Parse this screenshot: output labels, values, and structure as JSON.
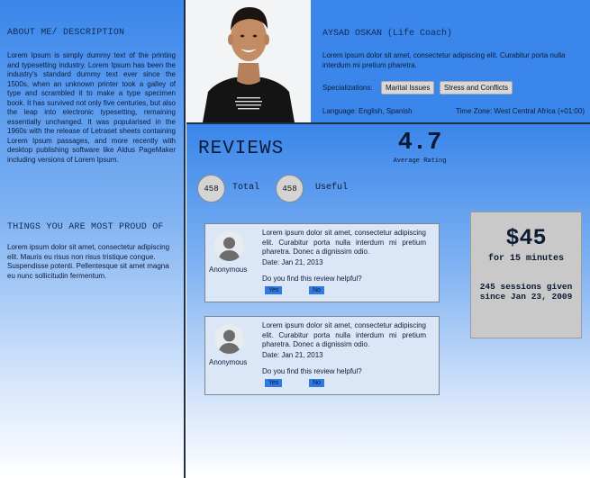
{
  "about": {
    "heading": "ABOUT ME/ DESCRIPTION",
    "text": "Lorem Ipsum is simply dummy text of the printing and typesetting industry. Lorem Ipsum has been the industry's standard dummy text ever since the 1500s, when an unknown printer took a galley of type and scrambled it to make a type specimen book. It has survived not only five centuries, but also the leap into electronic typesetting, remaining essentially unchanged. It was popularised in the 1960s with the release of Letraset sheets containing Lorem Ipsum passages, and more recently with desktop publishing software like Aldus PageMaker including versions of Lorem Ipsum."
  },
  "proud": {
    "heading": "THINGS YOU ARE MOST PROUD OF",
    "text": "Lorem ipsum dolor sit amet, consectetur adipiscing elit. Mauris eu risus non risus tristique congue. Suspendisse potenti. Pellentesque sit amet magna eu nunc sollicitudin fermentum."
  },
  "coach": {
    "name": "AYSAD OSKAN (Life Coach)",
    "description": "Lorem ipsum dolor sit amet, consectetur adipiscing elit. Curabitur porta nulla interdum mi pretium pharetra.",
    "specializations_label": "Specializations:",
    "specializations": [
      "Marital Issues",
      "Stress and Conflicts"
    ],
    "language": "Language: English, Spanish",
    "timezone": "Time Zone: West Central Africa (+01:00)"
  },
  "reviews": {
    "title": "REVIEWS",
    "average_rating": "4.7",
    "average_label": "Average Rating",
    "total_count": "458",
    "total_label": "Total",
    "useful_count": "458",
    "useful_label": "Useful",
    "items": [
      {
        "author": "Anonymous",
        "text": "Lorem ipsum dolor sit amet, consectetur adipiscing elit. Curabitur porta nulla interdum mi pretium pharetra. Donec a dignissim odio.",
        "date": "Date: Jan 21, 2013",
        "question": "Do you find this review helpful?",
        "yes": "Yes",
        "no": "No"
      },
      {
        "author": "Anonymous",
        "text": "Lorem ipsum dolor sit amet, consectetur adipiscing elit. Curabitur porta nulla interdum mi pretium pharetra. Donec a dignissim odio.",
        "date": "Date: Jan 21, 2013",
        "question": "Do you find this review helpful?",
        "yes": "Yes",
        "no": "No"
      }
    ]
  },
  "pricing": {
    "price": "$45",
    "per": "for 15 minutes",
    "sessions_line1": "245 sessions given",
    "sessions_line2": "since Jan 23, 2009"
  }
}
